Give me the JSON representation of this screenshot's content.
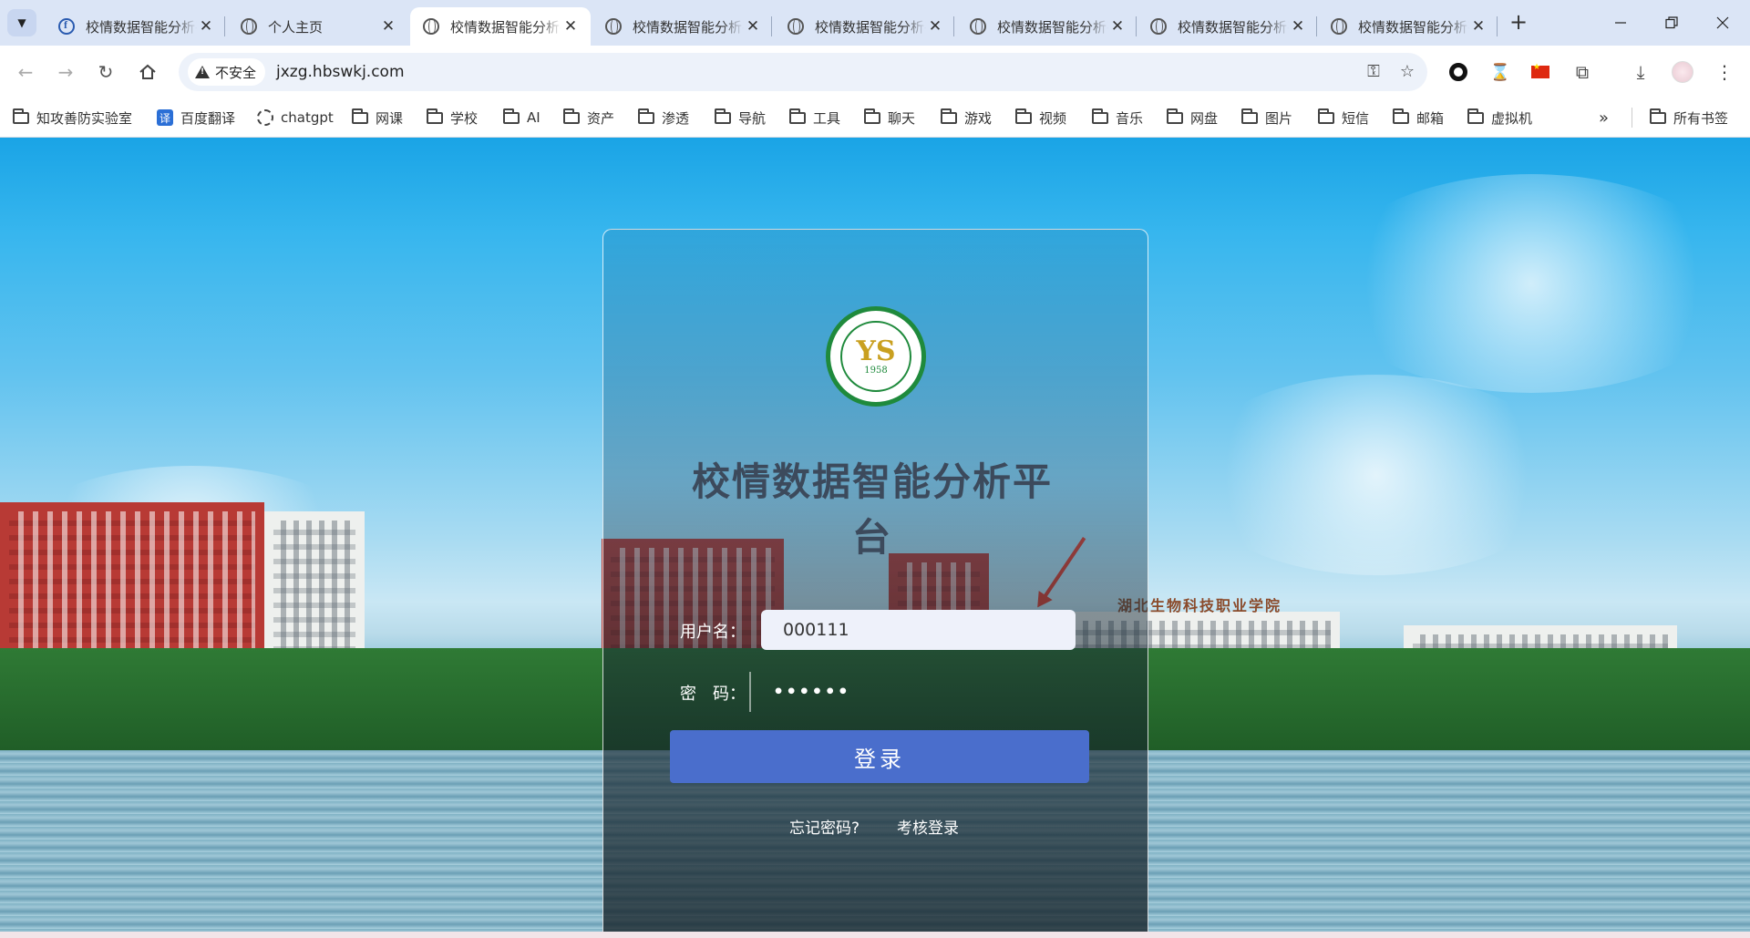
{
  "browser": {
    "tabs": [
      {
        "title": "校情数据智能分析平台",
        "favicon": "f-icon"
      },
      {
        "title": "个人主页",
        "favicon": "globe-icon"
      },
      {
        "title": "校情数据智能分析平台",
        "favicon": "globe-icon",
        "active": true
      },
      {
        "title": "校情数据智能分析平台",
        "favicon": "globe-icon"
      },
      {
        "title": "校情数据智能分析平台",
        "favicon": "globe-icon"
      },
      {
        "title": "校情数据智能分析平台",
        "favicon": "globe-icon"
      },
      {
        "title": "校情数据智能分析平台",
        "favicon": "globe-icon"
      },
      {
        "title": "校情数据智能分析平台",
        "favicon": "globe-icon"
      }
    ],
    "security_label": "不安全",
    "url": "jxzg.hbswkj.com",
    "bookmarks": [
      "知攻善防实验室",
      "百度翻译",
      "chatgpt",
      "网课",
      "学校",
      "AI",
      "资产",
      "渗透",
      "导航",
      "工具",
      "聊天",
      "游戏",
      "视频",
      "音乐",
      "网盘",
      "图片",
      "短信",
      "邮箱",
      "虚拟机"
    ],
    "all_bookmarks": "所有书签",
    "translate_icon_text": "译"
  },
  "page": {
    "logo_year": "1958",
    "logo_letters": "YS",
    "title": "校情数据智能分析平台",
    "school_sign": "湖北生物科技职业学院",
    "username_label": "用户名：",
    "username_value": "000111",
    "password_label": "密　码：",
    "password_value": "••••••",
    "login_button": "登录",
    "forgot_password": "忘记密码?",
    "assessment_login": "考核登录"
  },
  "colors": {
    "login_button": "#4a6ecc",
    "logo_green": "#1f8a3c",
    "annotation_arrow": "#e23a2a"
  }
}
